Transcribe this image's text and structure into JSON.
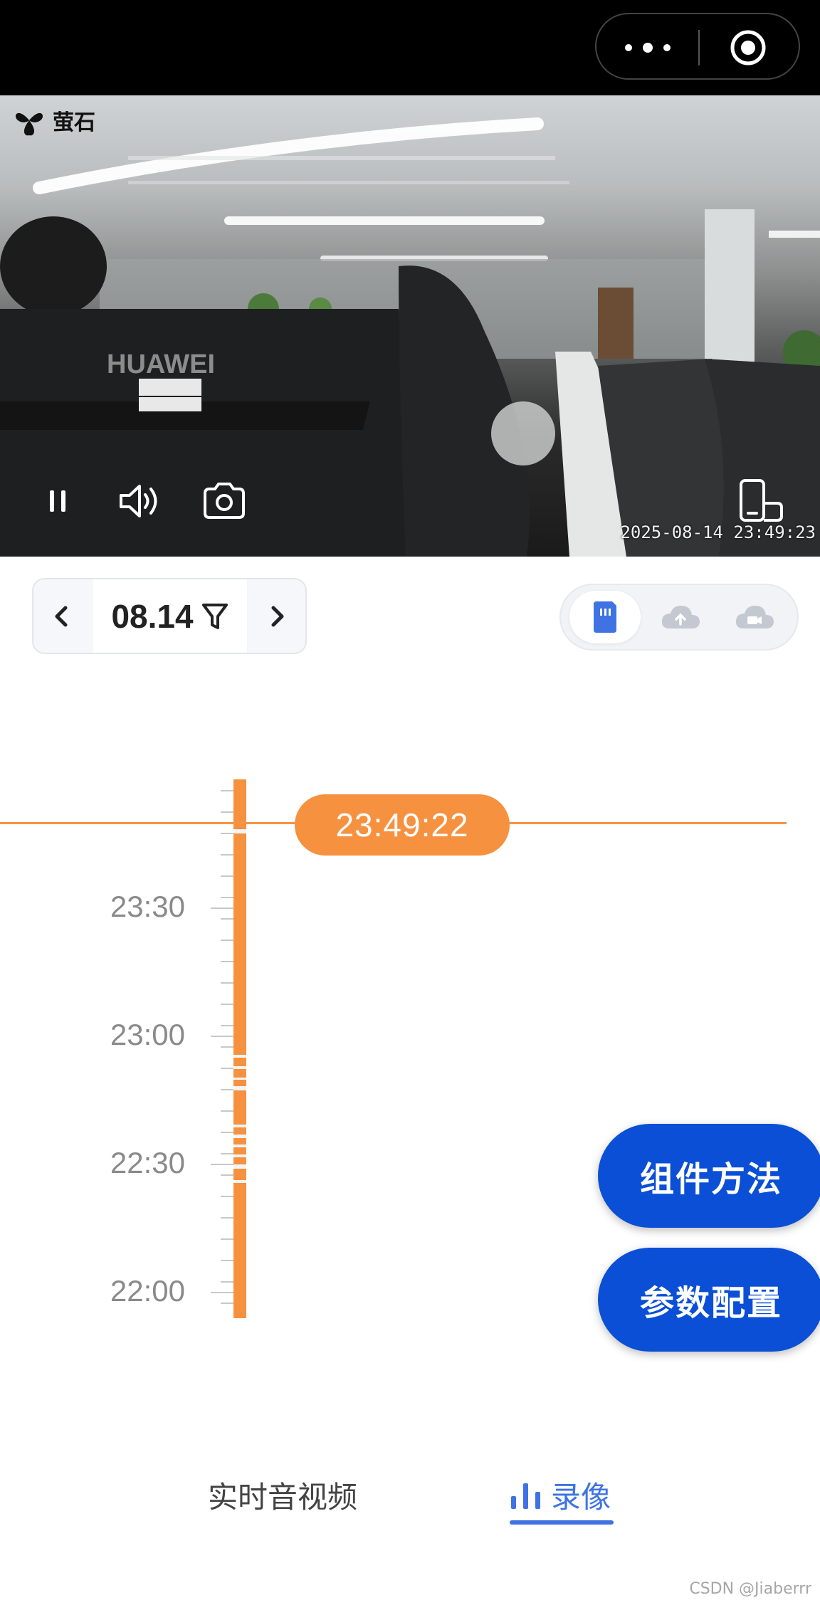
{
  "top_bar": {
    "more_icon": "more-dots-icon",
    "close_icon": "target-circle-icon"
  },
  "video": {
    "brand_name": "萤石",
    "timestamp": "2025-08-14 23:49:23",
    "controls": [
      "pause-icon",
      "volume-icon",
      "camera-snapshot-icon",
      "rotate-screen-icon"
    ]
  },
  "date_selector": {
    "date": "08.14",
    "prev_icon": "chevron-left-icon",
    "next_icon": "chevron-right-icon",
    "filter_icon": "filter-icon"
  },
  "source_toggle": {
    "options": [
      "sd-card-icon",
      "cloud-upload-icon",
      "cloud-camera-icon"
    ],
    "active_index": 0
  },
  "timeline": {
    "current_time": "23:49:22",
    "labels": [
      "23:30",
      "23:00",
      "22:30",
      "22:00"
    ]
  },
  "fab": {
    "component_methods": "组件方法",
    "param_config": "参数配置"
  },
  "tabs": {
    "live": "实时音视频",
    "recording": "录像",
    "active": "recording"
  },
  "watermark": "CSDN @Jiaberrr",
  "colors": {
    "accent_orange": "#f69140",
    "primary_blue": "#0a4fd6",
    "tab_active": "#3f73e3"
  }
}
